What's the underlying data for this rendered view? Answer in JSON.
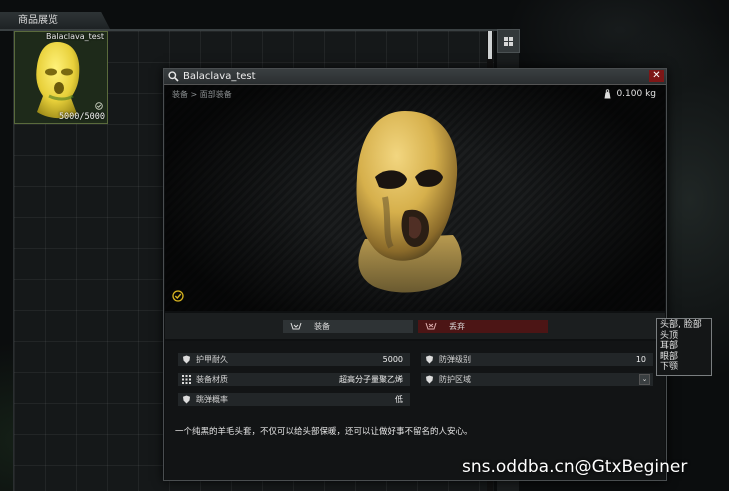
{
  "stash": {
    "title": "商品展览",
    "item": {
      "name": "Balaclava_test",
      "durability": "5000/5000"
    }
  },
  "window": {
    "title": "Balaclava_test",
    "close_label": "✕",
    "breadcrumb": "装备 > 面部装备",
    "weight": "0.100 kg",
    "actions": {
      "equip": "装备",
      "discard": "丢弃"
    },
    "stats": {
      "armor_durability": {
        "label": "护甲耐久",
        "value": "5000"
      },
      "armor_class": {
        "label": "防弹级别",
        "value": "10"
      },
      "material": {
        "label": "装备材质",
        "value": "超高分子量聚乙烯"
      },
      "protection_zone": {
        "label": "防护区域",
        "value": ""
      },
      "ricochet": {
        "label": "跳弹概率",
        "value": "低"
      }
    },
    "description": "一个纯黑的羊毛头套，不仅可以给头部保暖，还可以让做好事不留名的人安心。"
  },
  "tooltip": {
    "zones": [
      "头部, 脸部",
      "头顶",
      "耳部",
      "眼部",
      "下颚"
    ]
  },
  "watermark": "sns.oddba.cn@GtxBeginer",
  "colors": {
    "discard_bg": "#4c1515",
    "close_bg": "#7d1616",
    "check": "#d9b520"
  }
}
